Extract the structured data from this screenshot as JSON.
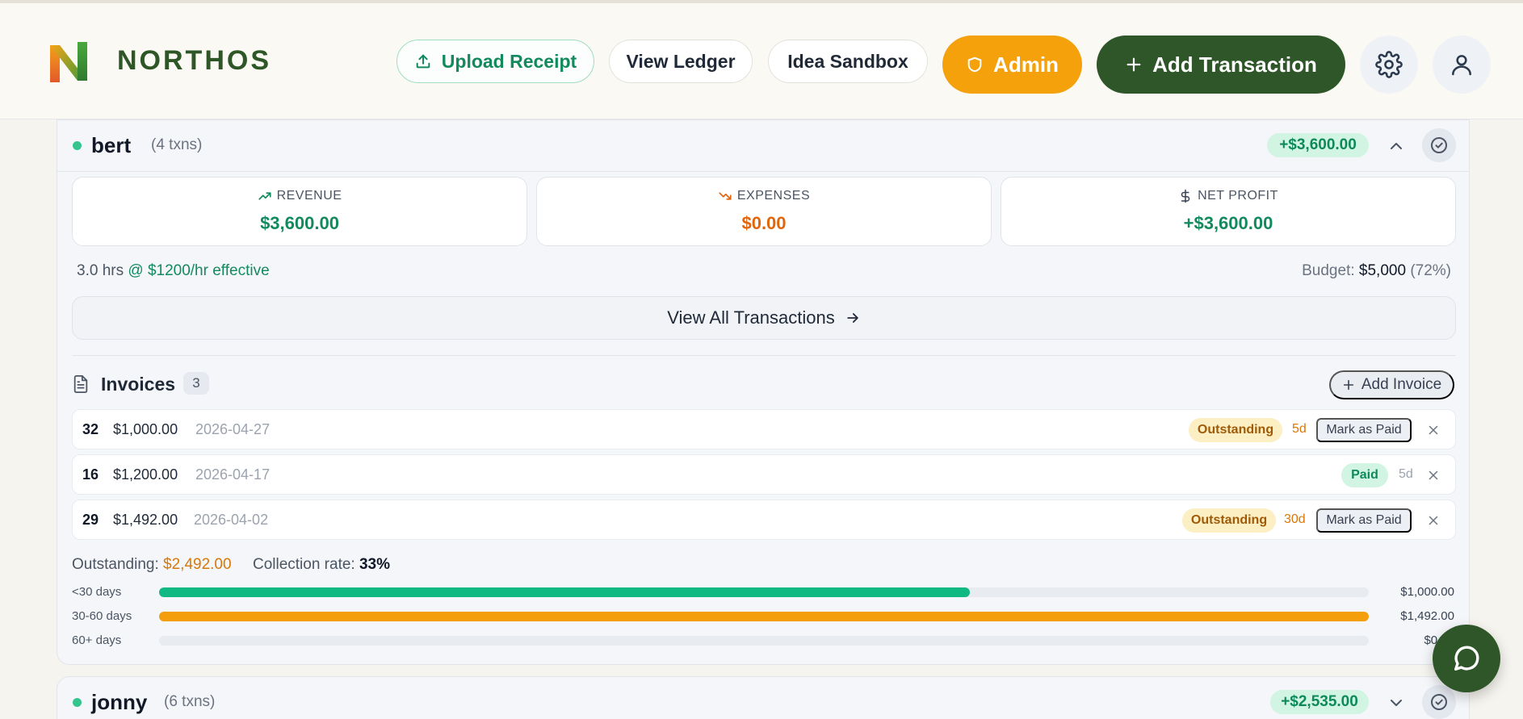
{
  "brand": {
    "name": "NORTHOS"
  },
  "header": {
    "upload_label": "Upload Receipt",
    "ledger_label": "View Ledger",
    "sandbox_label": "Idea Sandbox",
    "admin_label": "Admin",
    "add_label": "Add Transaction"
  },
  "colors": {
    "brand_green": "#2f5628",
    "accent_orange": "#f4a10c",
    "success": "#138a5e",
    "warning": "#d9770a"
  },
  "clients": [
    {
      "name": "bert",
      "txns": "(4 txns)",
      "total": "+$3,600.00",
      "expanded": true,
      "stats": {
        "revenue_label": "REVENUE",
        "revenue_value": "$3,600.00",
        "expenses_label": "EXPENSES",
        "expenses_value": "$0.00",
        "profit_label": "NET PROFIT",
        "profit_value": "+$3,600.00"
      },
      "hours": "3.0 hrs",
      "effective_rate": "@ $1200/hr effective",
      "budget_label": "Budget:",
      "budget_value": "$5,000",
      "budget_pct": "(72%)",
      "view_all_label": "View All Transactions",
      "invoices": {
        "title": "Invoices",
        "count": "3",
        "add_label": "Add Invoice",
        "items": [
          {
            "num": "32",
            "amount": "$1,000.00",
            "date": "2026-04-27",
            "status": "Outstanding",
            "age": "5d",
            "action": "Mark as Paid"
          },
          {
            "num": "16",
            "amount": "$1,200.00",
            "date": "2026-04-17",
            "status": "Paid",
            "age": "5d",
            "action": ""
          },
          {
            "num": "29",
            "amount": "$1,492.00",
            "date": "2026-04-02",
            "status": "Outstanding",
            "age": "30d",
            "action": "Mark as Paid"
          }
        ]
      },
      "summary": {
        "outstanding_label": "Outstanding:",
        "outstanding_value": "$2,492.00",
        "collection_label": "Collection rate:",
        "collection_value": "33%"
      },
      "aging": [
        {
          "label": "<30 days",
          "amount": "$1,000.00",
          "fraction": 0.67,
          "color": "#10b981"
        },
        {
          "label": "30-60 days",
          "amount": "$1,492.00",
          "fraction": 1.0,
          "color": "#f59e0b"
        },
        {
          "label": "60+ days",
          "amount": "$0.00",
          "fraction": 0.0,
          "color": "#e8ebf0"
        }
      ]
    },
    {
      "name": "jonny",
      "txns": "(6 txns)",
      "total": "+$2,535.00",
      "expanded": false
    }
  ],
  "icons": {
    "upload": "upload-icon",
    "shield": "shield-icon",
    "plus": "plus-icon",
    "settings": "gear-icon",
    "profile": "user-icon",
    "chat": "chat-icon"
  }
}
